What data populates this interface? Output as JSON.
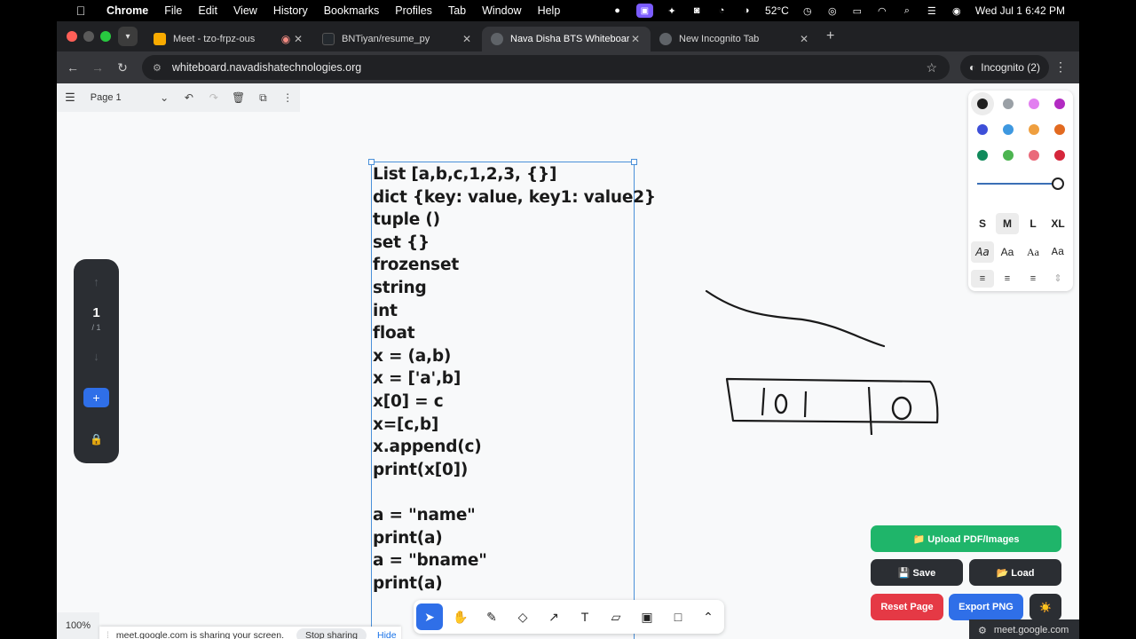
{
  "menubar": {
    "app": "Chrome",
    "items": [
      "File",
      "Edit",
      "View",
      "History",
      "Bookmarks",
      "Profiles",
      "Tab",
      "Window",
      "Help"
    ],
    "temperature": "52°C",
    "datetime": "Wed Jul 1  6:42 PM"
  },
  "tabs": [
    {
      "label": "Meet - tzo-frpz-ous",
      "icon": "meet-icon",
      "color": "#f9ab00"
    },
    {
      "label": "BNTiyan/resume_py",
      "icon": "github-icon",
      "color": "#24292e"
    },
    {
      "label": "Nava Disha BTS Whiteboard",
      "icon": "globe-icon",
      "color": "#9aa0a6"
    },
    {
      "label": "New Incognito Tab",
      "icon": "incognito-icon",
      "color": "#9aa0a6"
    }
  ],
  "address": {
    "url": "whiteboard.navadishatechnologies.org",
    "incognito": "Incognito (2)"
  },
  "whiteboard": {
    "page_name": "Page 1",
    "nav_current": "1",
    "nav_total": "/ 1",
    "zoom": "100%",
    "code_lines": [
      "List [a,b,c,1,2,3, {}]",
      "dict {key: value, key1: value2}",
      "tuple ()",
      "set {}",
      "frozenset",
      "string",
      "int",
      "float",
      "x = (a,b)",
      "x = ['a',b]",
      "x[0] = c",
      "x=[c,b]",
      "x.append(c)",
      "print(x[0])",
      "",
      "a = \"name\"",
      "print(a)",
      "a = \"bname\"",
      "print(a)"
    ],
    "colors": [
      "#1e1e1e",
      "#9aa0a6",
      "#e27ff0",
      "#b22bc2",
      "#3d4fd8",
      "#3e98e0",
      "#ef9f3f",
      "#e26a20",
      "#118a5c",
      "#4cb450",
      "#ea6a7a",
      "#d5263b"
    ],
    "sizes": [
      "S",
      "M",
      "L",
      "XL"
    ],
    "font_sample": "Aa",
    "buttons": {
      "upload": "📁 Upload PDF/Images",
      "save": "💾 Save",
      "load": "📂 Load",
      "reset": "Reset Page",
      "export": "Export PNG",
      "theme": "☀️"
    }
  },
  "sharing": {
    "message": "meet.google.com is sharing your screen.",
    "stop": "Stop sharing",
    "hide": "Hide"
  },
  "meet_chip": "meet.google.com"
}
